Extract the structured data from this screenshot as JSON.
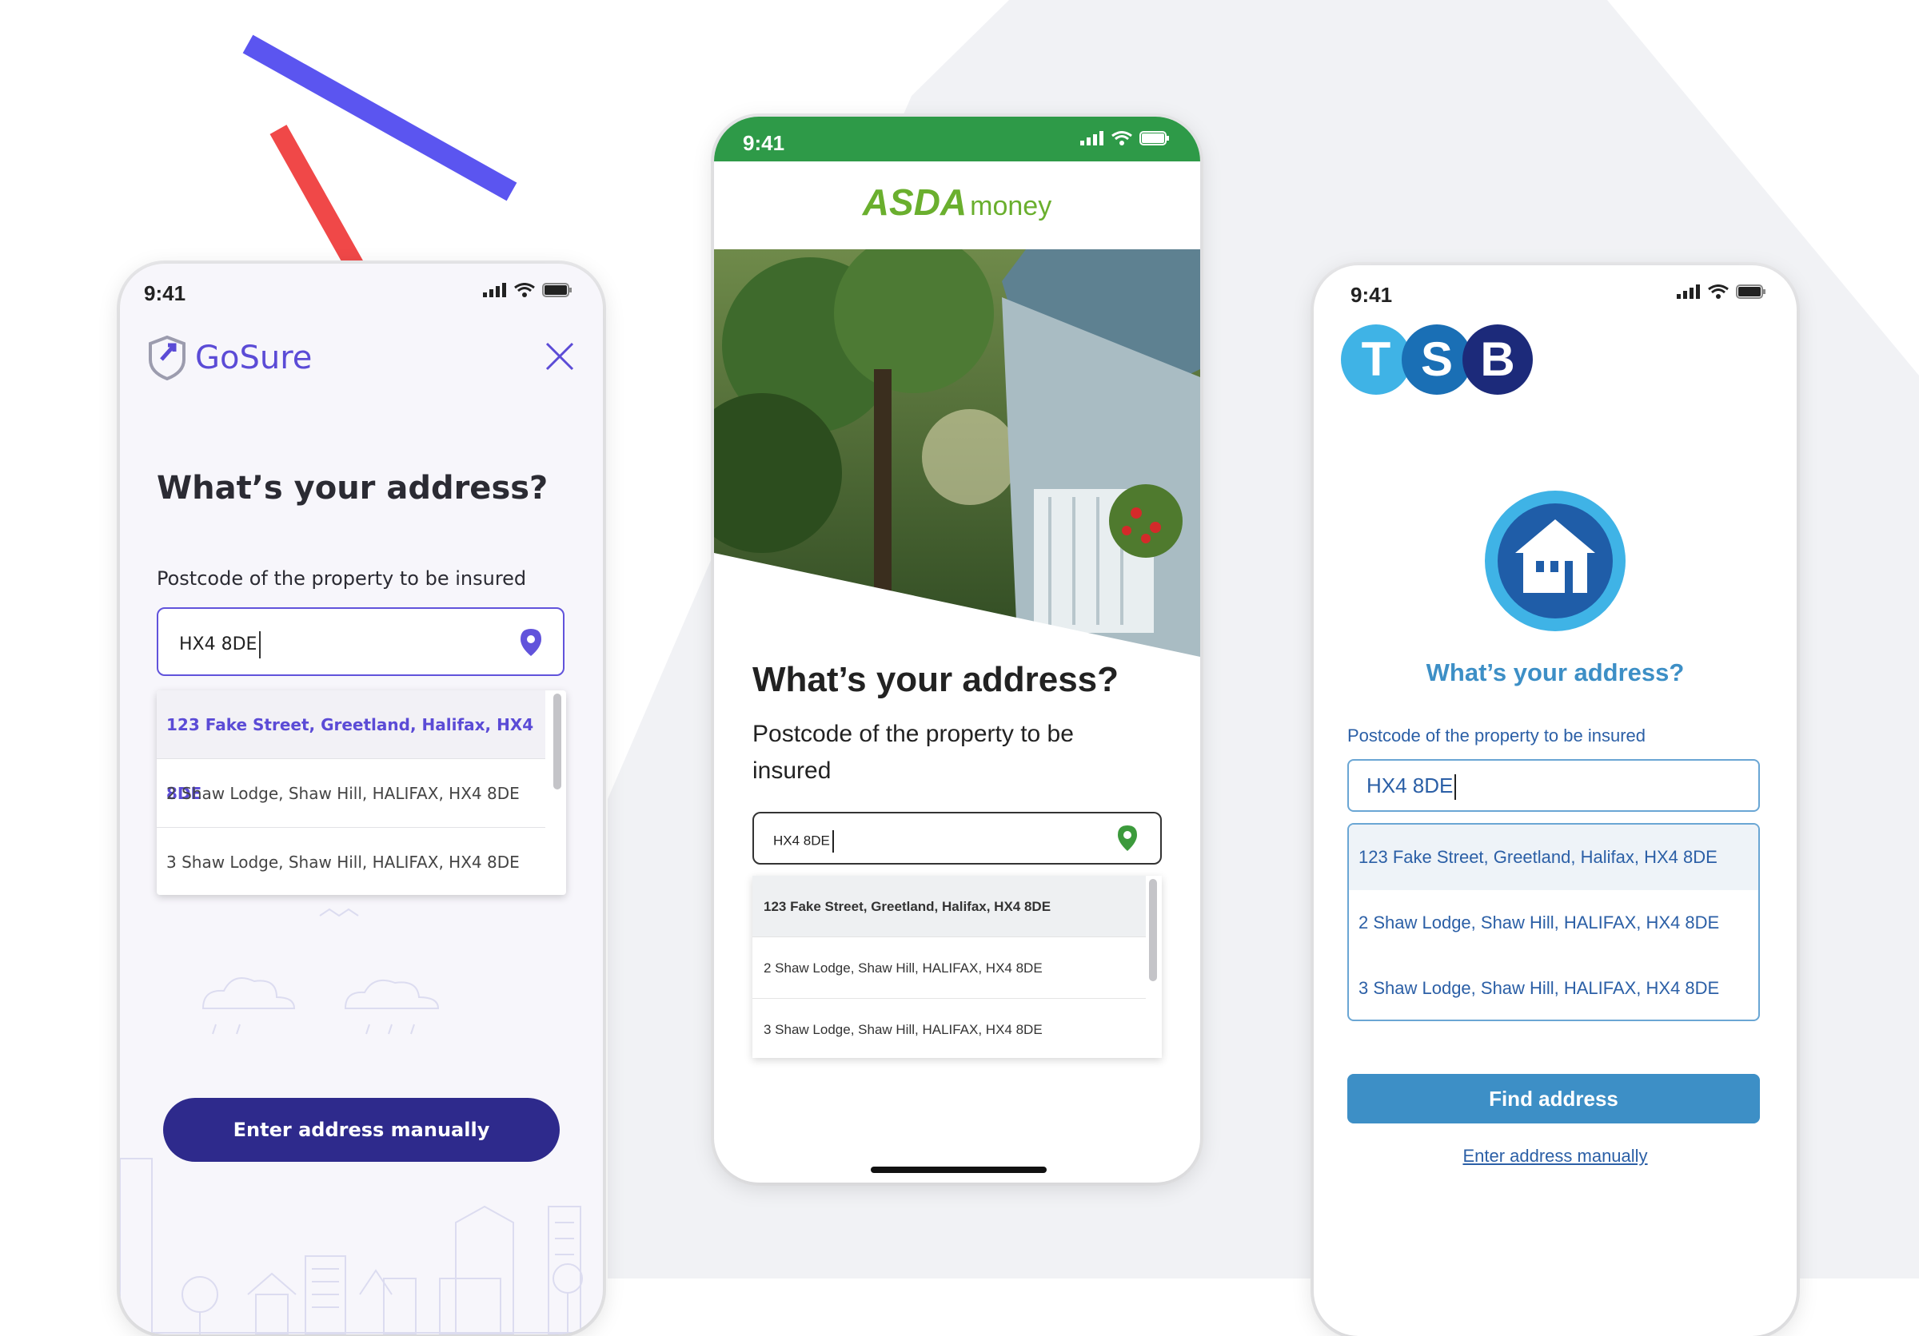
{
  "colors": {
    "gosure_purple": "#5b4bd6",
    "gosure_button": "#2e2a8c",
    "asda_green": "#2e9a48",
    "tsb_blue": "#3d8fc6",
    "tsb_dark": "#2b5fa6"
  },
  "gosure": {
    "status_time": "9:41",
    "brand": "GoSure",
    "title": "What’s your address?",
    "label": "Postcode of the property to be insured",
    "input_value": "HX4 8DE",
    "suggestions": [
      "123 Fake Street, Greetland, Halifax, HX4 8DE",
      "2 Shaw Lodge, Shaw Hill, HALIFAX, HX4 8DE",
      "3 Shaw Lodge, Shaw Hill, HALIFAX, HX4 8DE"
    ],
    "button": "Enter address manually"
  },
  "asda": {
    "status_time": "9:41",
    "brand_main": "ASDA",
    "brand_sub": "money",
    "title": "What’s your address?",
    "label": "Postcode of the property to be insured",
    "input_value": "HX4 8DE",
    "suggestions": [
      "123 Fake Street, Greetland, Halifax, HX4 8DE",
      "2 Shaw Lodge, Shaw Hill, HALIFAX, HX4 8DE",
      "3 Shaw Lodge, Shaw Hill, HALIFAX, HX4 8DE"
    ]
  },
  "tsb": {
    "status_time": "9:41",
    "logo_letters": [
      "T",
      "S",
      "B"
    ],
    "title": "What’s your address?",
    "label": "Postcode of the property to be insured",
    "input_value": "HX4 8DE",
    "suggestions": [
      "123 Fake Street, Greetland, Halifax, HX4 8DE",
      "2 Shaw Lodge, Shaw Hill, HALIFAX, HX4 8DE",
      "3 Shaw Lodge, Shaw Hill, HALIFAX, HX4 8DE"
    ],
    "button": "Find address",
    "link": "Enter address manually"
  }
}
